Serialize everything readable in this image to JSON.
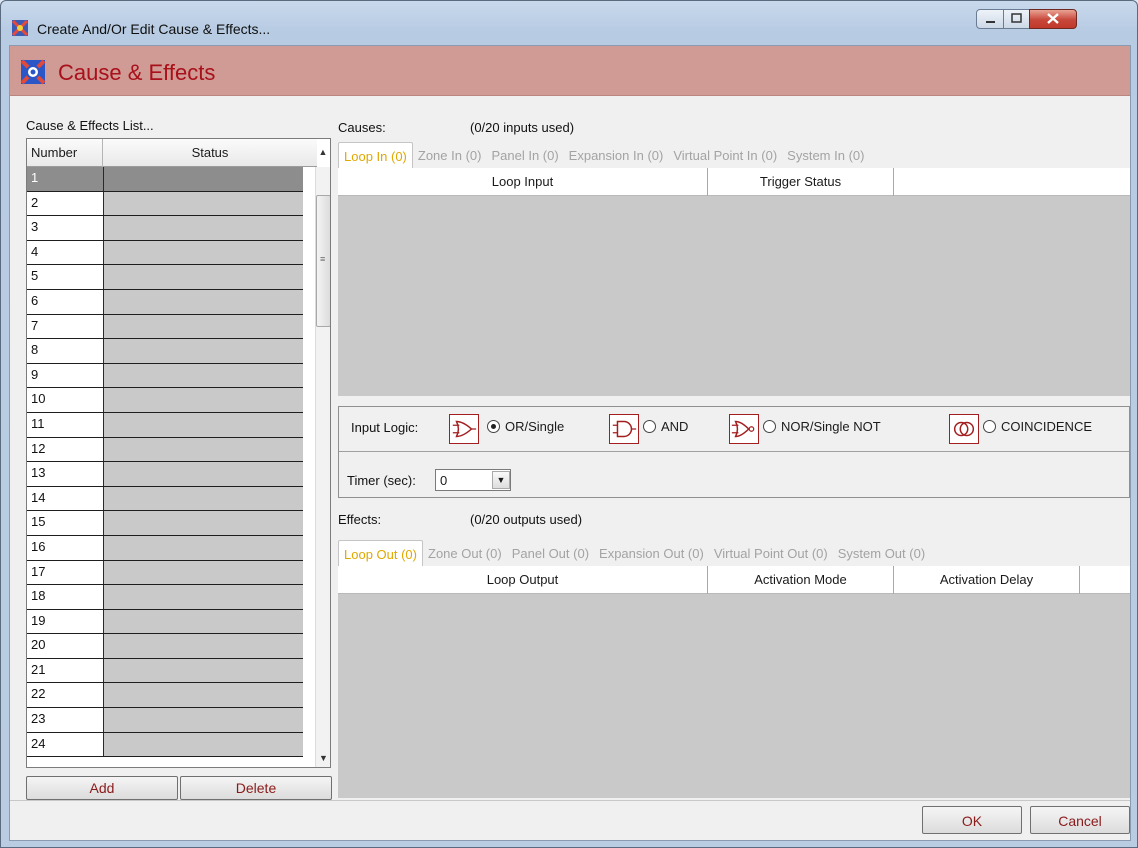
{
  "window": {
    "title": "Create And/Or Edit Cause & Effects..."
  },
  "banner": {
    "title": "Cause & Effects"
  },
  "list": {
    "label": "Cause & Effects List...",
    "columns": [
      "Number",
      "Status"
    ],
    "rows": [
      "1",
      "2",
      "3",
      "4",
      "5",
      "6",
      "7",
      "8",
      "9",
      "10",
      "11",
      "12",
      "13",
      "14",
      "15",
      "16",
      "17",
      "18",
      "19",
      "20",
      "21",
      "22",
      "23",
      "24"
    ],
    "selected": "1",
    "add_label": "Add",
    "delete_label": "Delete"
  },
  "causes": {
    "label": "Causes:",
    "usage": "(0/20 inputs used)",
    "tabs": [
      "Loop In (0)",
      "Zone In (0)",
      "Panel In (0)",
      "Expansion In (0)",
      "Virtual Point In (0)",
      "System In (0)"
    ],
    "active_tab": "Loop In (0)",
    "columns": [
      "Loop Input",
      "Trigger Status"
    ]
  },
  "logic": {
    "label": "Input Logic:",
    "options": [
      "OR/Single",
      "AND",
      "NOR/Single NOT",
      "COINCIDENCE"
    ],
    "selected": "OR/Single",
    "timer_label": "Timer (sec):",
    "timer_value": "0"
  },
  "effects": {
    "label": "Effects:",
    "usage": "(0/20 outputs used)",
    "tabs": [
      "Loop Out (0)",
      "Zone Out (0)",
      "Panel Out (0)",
      "Expansion Out (0)",
      "Virtual Point Out (0)",
      "System Out (0)"
    ],
    "active_tab": "Loop Out (0)",
    "columns": [
      "Loop Output",
      "Activation Mode",
      "Activation Delay"
    ]
  },
  "footer": {
    "ok_label": "OK",
    "cancel_label": "Cancel"
  },
  "colors": {
    "accent": "#a8101a",
    "banner": "#d09a95",
    "active_tab": "#e0a800"
  }
}
